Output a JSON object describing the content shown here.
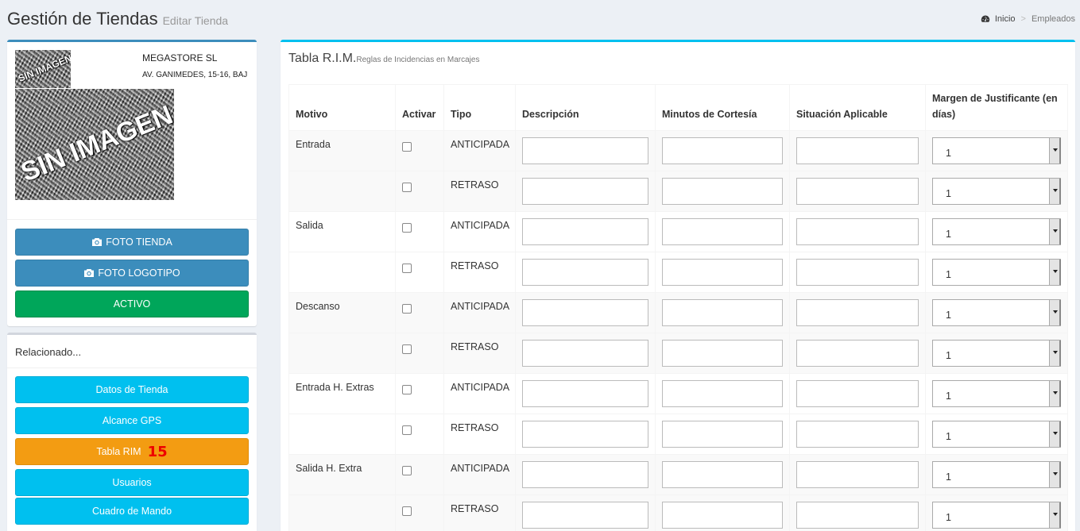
{
  "header": {
    "title": "Gestión de Tiendas",
    "subtitle": "Editar Tienda",
    "breadcrumb": [
      "Inicio",
      "Empleados"
    ]
  },
  "store": {
    "name": "MEGASTORE SL",
    "address": "AV. GANIMEDES, 15-16, BAJ",
    "placeholder_image_text": "SIN IMAGEN",
    "buttons": {
      "foto_tienda": "FOTO TIENDA",
      "foto_logotipo": "FOTO LOGOTIPO",
      "activo": "ACTIVO"
    }
  },
  "related": {
    "title": "Relacionado...",
    "items": [
      {
        "label": "Datos de Tienda",
        "badge": ""
      },
      {
        "label": "Alcance GPS",
        "badge": ""
      },
      {
        "label": "Tabla RIM",
        "badge": "15"
      },
      {
        "label": "Usuarios",
        "badge": ""
      },
      {
        "label": "Cuadro de Mando",
        "badge": ""
      }
    ]
  },
  "rim": {
    "title": "Tabla R.I.M.",
    "subtitle": "Reglas de Incidencias en Marcajes",
    "columns": [
      "Motivo",
      "Activar",
      "Tipo",
      "Descripción",
      "Minutos de Cortesía",
      "Situación Aplicable",
      "Margen de Justificante (en días)"
    ],
    "rows": [
      {
        "motivo": "Entrada",
        "tipo": "ANTICIPADA",
        "margen": "1"
      },
      {
        "motivo": "",
        "tipo": "RETRASO",
        "margen": "1"
      },
      {
        "motivo": "Salida",
        "tipo": "ANTICIPADA",
        "margen": "1"
      },
      {
        "motivo": "",
        "tipo": "RETRASO",
        "margen": "1"
      },
      {
        "motivo": "Descanso",
        "tipo": "ANTICIPADA",
        "margen": "1"
      },
      {
        "motivo": "",
        "tipo": "RETRASO",
        "margen": "1"
      },
      {
        "motivo": "Entrada H. Extras",
        "tipo": "ANTICIPADA",
        "margen": "1"
      },
      {
        "motivo": "",
        "tipo": "RETRASO",
        "margen": "1"
      },
      {
        "motivo": "Salida H. Extra",
        "tipo": "ANTICIPADA",
        "margen": "1"
      },
      {
        "motivo": "",
        "tipo": "RETRASO",
        "margen": "1"
      }
    ]
  },
  "colors": {
    "primary": "#3c8dbc",
    "success": "#00a65a",
    "info": "#00c0ef",
    "warning": "#f39c12",
    "badge": "#ee0000"
  }
}
